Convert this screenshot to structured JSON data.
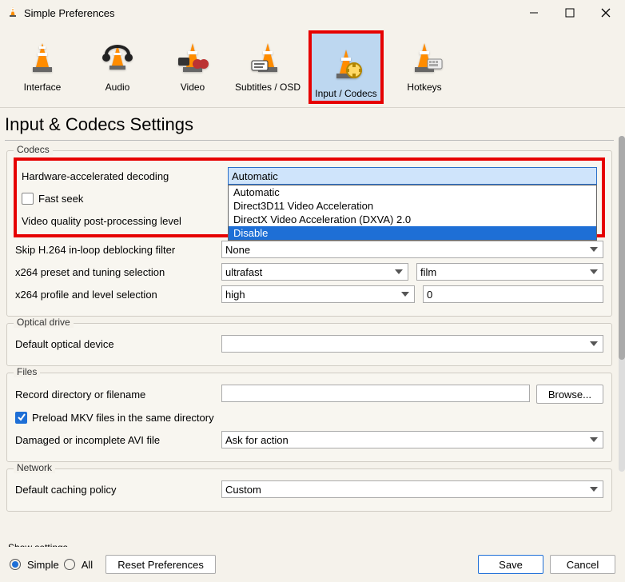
{
  "window": {
    "title": "Simple Preferences"
  },
  "tabs": [
    {
      "label": "Interface"
    },
    {
      "label": "Audio"
    },
    {
      "label": "Video"
    },
    {
      "label": "Subtitles / OSD"
    },
    {
      "label": "Input / Codecs"
    },
    {
      "label": "Hotkeys"
    }
  ],
  "page_title": "Input & Codecs Settings",
  "codecs": {
    "legend": "Codecs",
    "hw_label": "Hardware-accelerated decoding",
    "hw_value": "Automatic",
    "hw_options": [
      "Automatic",
      "Direct3D11 Video Acceleration",
      "DirectX Video Acceleration (DXVA) 2.0",
      "Disable"
    ],
    "fast_seek_label": "Fast seek",
    "vq_label": "Video quality post-processing level",
    "skip_label": "Skip H.264 in-loop deblocking filter",
    "skip_value": "None",
    "x264preset_label": "x264 preset and tuning selection",
    "x264preset_value": "ultrafast",
    "x264tune_value": "film",
    "x264profile_label": "x264 profile and level selection",
    "x264profile_value": "high",
    "x264level_value": "0"
  },
  "optical": {
    "legend": "Optical drive",
    "default_label": "Default optical device",
    "default_value": ""
  },
  "files": {
    "legend": "Files",
    "record_label": "Record directory or filename",
    "record_value": "",
    "browse_label": "Browse...",
    "preload_label": "Preload MKV files in the same directory",
    "damaged_label": "Damaged or incomplete AVI file",
    "damaged_value": "Ask for action"
  },
  "network": {
    "legend": "Network",
    "caching_label": "Default caching policy",
    "caching_value": "Custom"
  },
  "footer": {
    "show_settings": "Show settings",
    "simple": "Simple",
    "all": "All",
    "reset": "Reset Preferences",
    "save": "Save",
    "cancel": "Cancel"
  }
}
